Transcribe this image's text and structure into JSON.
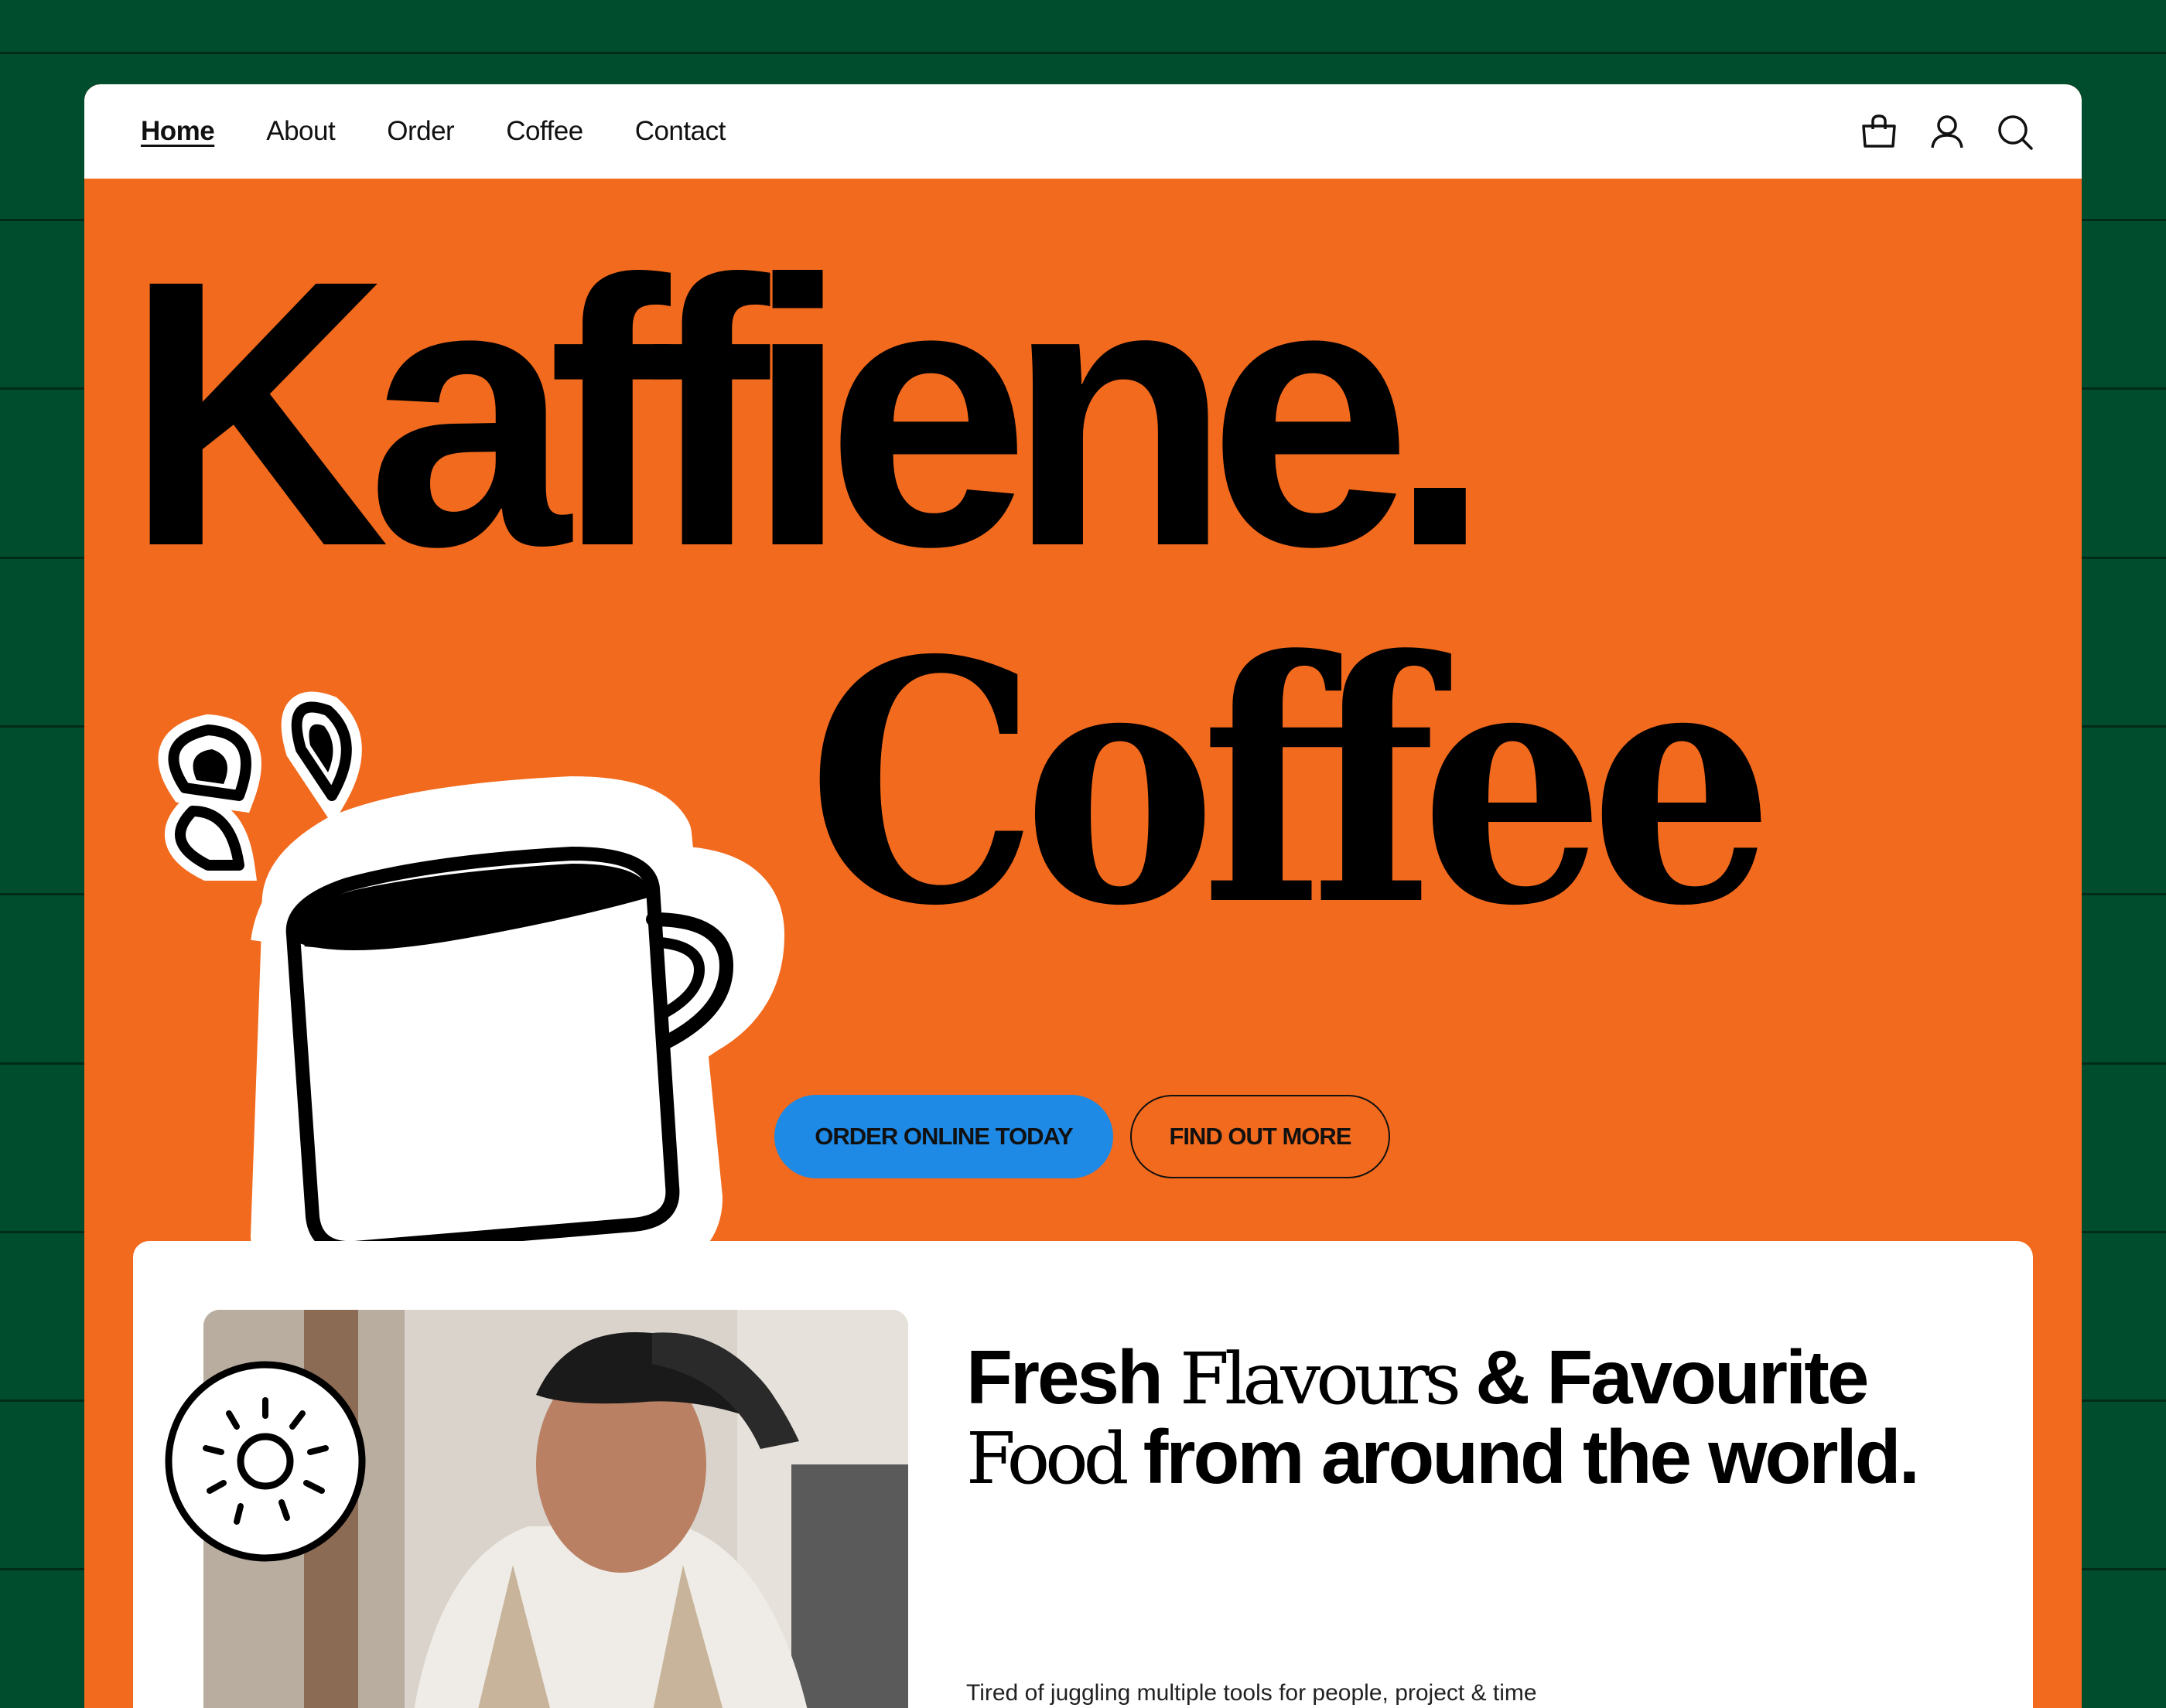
{
  "nav": {
    "links": [
      {
        "label": "Home",
        "active": true
      },
      {
        "label": "About"
      },
      {
        "label": "Order"
      },
      {
        "label": "Coffee"
      },
      {
        "label": "Contact"
      }
    ],
    "icons": [
      "shopping-bag-icon",
      "user-icon",
      "search-icon"
    ]
  },
  "hero": {
    "title": "Kaffiene.",
    "subtitle": "Coffee",
    "primary_cta": "ORDER ONLINE TODAY",
    "secondary_cta": "FIND OUT MORE"
  },
  "feature": {
    "heading_1": "Fresh",
    "heading_2": "Flavours",
    "heading_3": "& Favourite",
    "heading_4": "Food",
    "heading_5": "from around the world.",
    "body": "Tired of juggling multiple tools for people, project & time"
  },
  "colors": {
    "background": "#004d2e",
    "hero": "#f26a1d",
    "primary_button": "#1e8ae6",
    "card": "#ffffff",
    "text": "#000000"
  }
}
